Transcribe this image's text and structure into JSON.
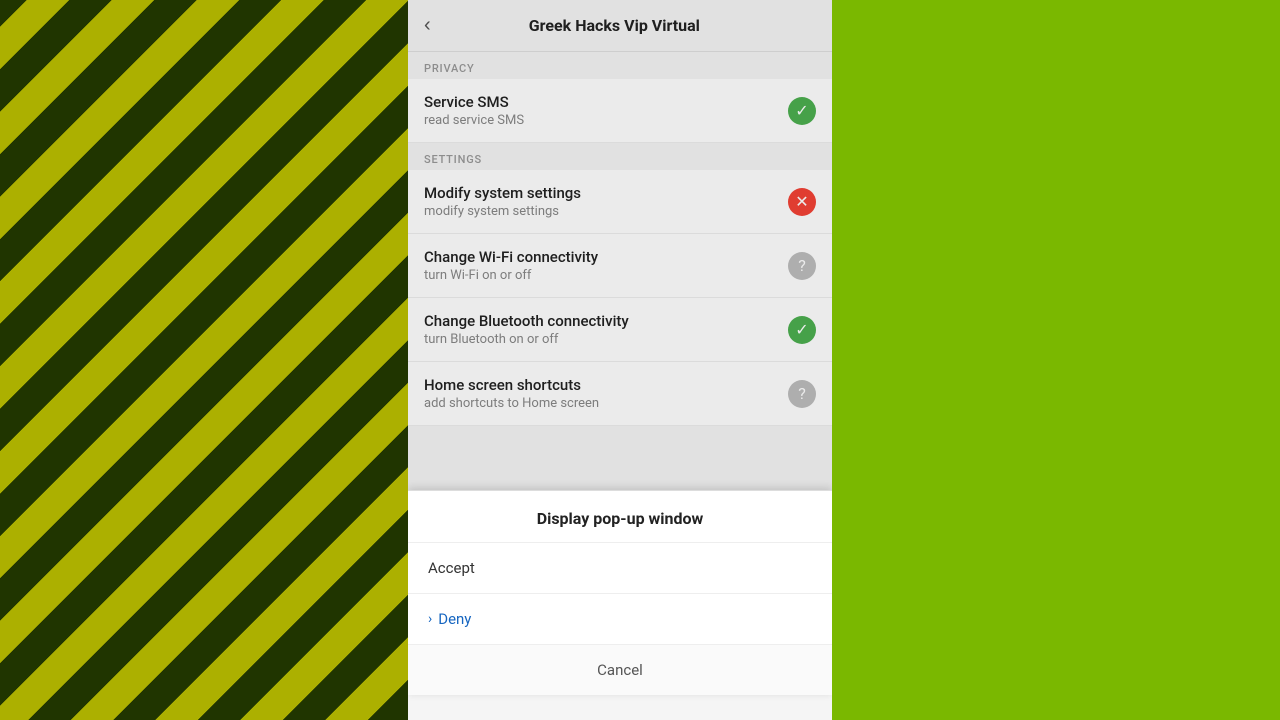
{
  "background": {
    "color": "#6ab000"
  },
  "header": {
    "back_label": "‹",
    "title": "Greek Hacks Vip Virtual"
  },
  "sections": [
    {
      "label": "PRIVACY",
      "items": [
        {
          "title": "Service SMS",
          "subtitle": "read service SMS",
          "status": "green",
          "status_icon": "✓"
        }
      ]
    },
    {
      "label": "SETTINGS",
      "items": [
        {
          "title": "Modify system settings",
          "subtitle": "modify system settings",
          "status": "red",
          "status_icon": "✕"
        },
        {
          "title": "Change Wi-Fi connectivity",
          "subtitle": "turn Wi-Fi on or off",
          "status": "gray",
          "status_icon": "?"
        },
        {
          "title": "Change Bluetooth connectivity",
          "subtitle": "turn Bluetooth on or off",
          "status": "green",
          "status_icon": "✓"
        },
        {
          "title": "Home screen shortcuts",
          "subtitle": "add shortcuts to Home screen",
          "status": "gray",
          "status_icon": "?"
        }
      ]
    }
  ],
  "dialog": {
    "title": "Display pop-up window",
    "accept_label": "Accept",
    "deny_label": "Deny",
    "deny_chevron": "›",
    "cancel_label": "Cancel"
  }
}
